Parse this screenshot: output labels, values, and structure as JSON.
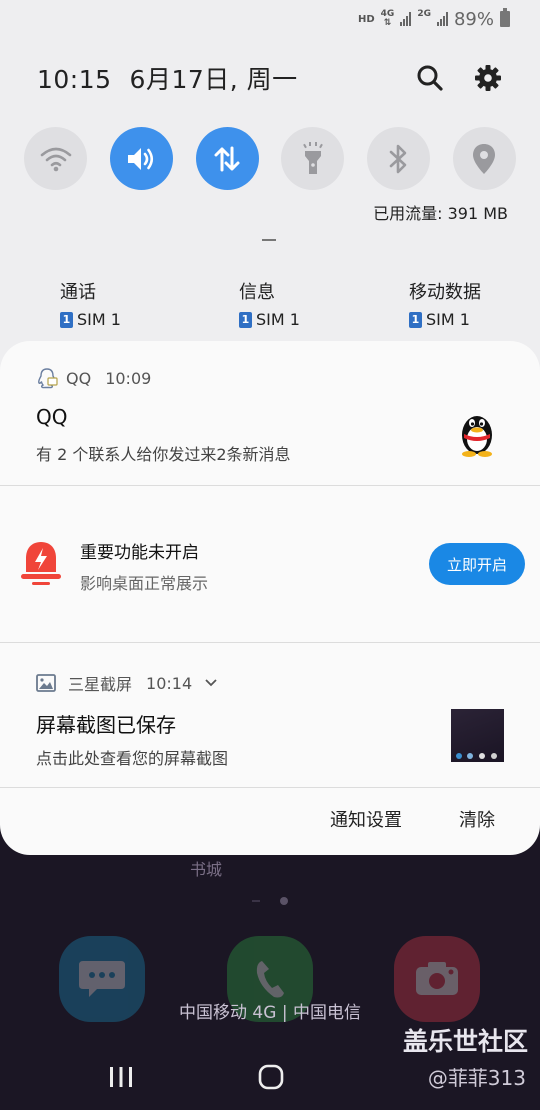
{
  "status_bar": {
    "hd": "HD",
    "net1": "4G",
    "net2": "2G",
    "battery": "89%"
  },
  "header": {
    "time": "10:15",
    "date": "6月17日, 周一"
  },
  "quick_toggles": [
    {
      "icon": "wifi-icon",
      "on": false
    },
    {
      "icon": "sound-icon",
      "on": true
    },
    {
      "icon": "mobile-data-icon",
      "on": true
    },
    {
      "icon": "flashlight-icon",
      "on": false
    },
    {
      "icon": "bluetooth-icon",
      "on": false
    },
    {
      "icon": "location-icon",
      "on": false
    }
  ],
  "data_usage": "已用流量: 391 MB",
  "sim_prefs": [
    {
      "label": "通话",
      "sim_num": "1",
      "sim": "SIM 1"
    },
    {
      "label": "信息",
      "sim_num": "1",
      "sim": "SIM 1"
    },
    {
      "label": "移动数据",
      "sim_num": "1",
      "sim": "SIM 1"
    }
  ],
  "notifications": {
    "qq": {
      "app": "QQ",
      "time": "10:09",
      "title": "QQ",
      "text": "有 2 个联系人给你发过来2条新消息"
    },
    "feature": {
      "title": "重要功能未开启",
      "text": "影响桌面正常展示",
      "button": "立即开启"
    },
    "screenshot": {
      "app": "三星截屏",
      "time": "10:14",
      "title": "屏幕截图已保存",
      "text": "点击此处查看您的屏幕截图"
    }
  },
  "panel_actions": {
    "settings": "通知设置",
    "clear": "清除"
  },
  "home": {
    "label": "书城",
    "carrier": "中国移动 4G | 中国电信"
  },
  "watermark": {
    "line1": "盖乐世社区",
    "line2": "@菲菲313"
  },
  "colors": {
    "accent": "#3e91ec",
    "button": "#1a88e5"
  }
}
